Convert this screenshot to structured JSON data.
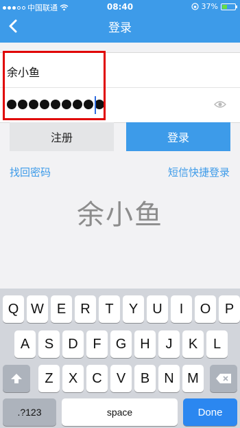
{
  "status": {
    "carrier": "中国联通",
    "time": "08:40",
    "battery": "37%",
    "battery_level": 0.37
  },
  "nav": {
    "title": "登录"
  },
  "form": {
    "username": "余小鱼",
    "password_dot_count": 9
  },
  "buttons": {
    "register": "注册",
    "login": "登录"
  },
  "links": {
    "forgot": "找回密码",
    "sms": "短信快捷登录"
  },
  "display_name": "余小鱼",
  "keyboard": {
    "row1": [
      "Q",
      "W",
      "E",
      "R",
      "T",
      "Y",
      "U",
      "I",
      "O",
      "P"
    ],
    "row2": [
      "A",
      "S",
      "D",
      "F",
      "G",
      "H",
      "J",
      "K",
      "L"
    ],
    "row3": [
      "Z",
      "X",
      "C",
      "V",
      "B",
      "N",
      "M"
    ],
    "numbers": ".?123",
    "space": "space",
    "done": "Done"
  },
  "colors": {
    "accent": "#3d9be9",
    "highlight": "#e00000"
  }
}
